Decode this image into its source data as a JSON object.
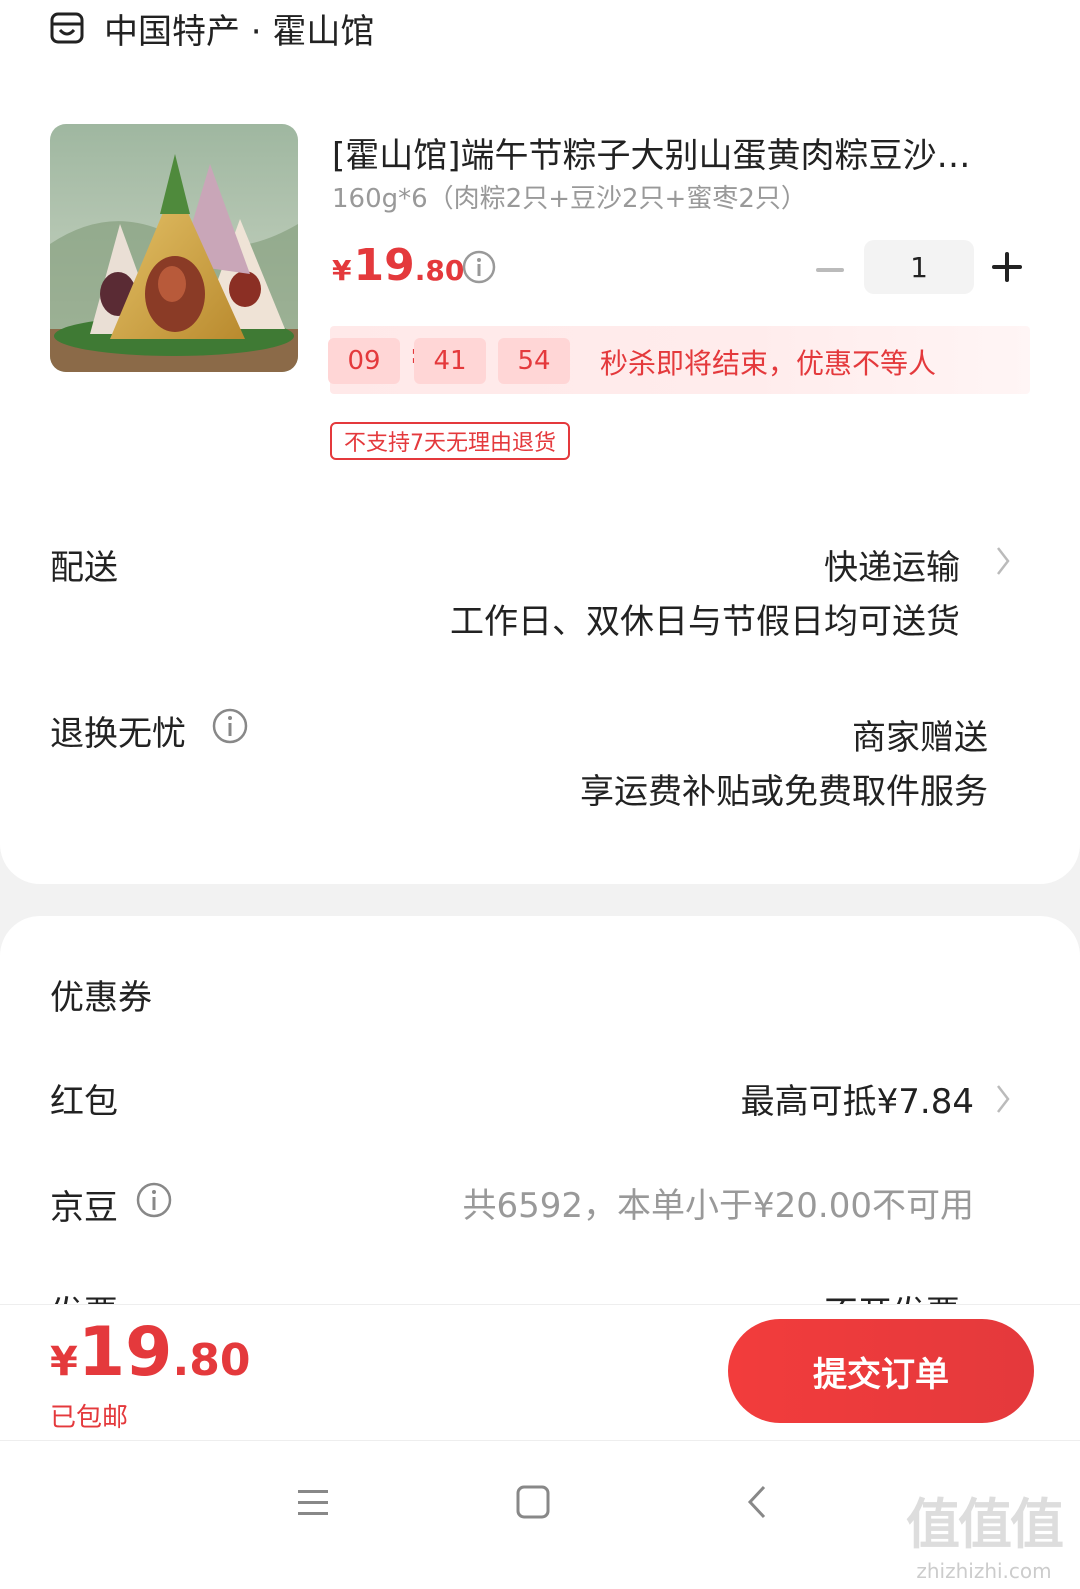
{
  "shop": {
    "icon": "store-icon",
    "name": "中国特产 · 霍山馆"
  },
  "product": {
    "image": "zongzi-product-image",
    "title": "[霍山馆]端午节粽子大别山蛋黄肉粽豆沙…",
    "spec": "160g*6（肉粽2只+豆沙2只+蜜枣2只）",
    "price": {
      "symbol": "¥",
      "integer": "19",
      "decimal": ".80"
    },
    "quantity": "1",
    "countdown": {
      "hours": "09",
      "minutes": "41",
      "seconds": "54",
      "message": "秒杀即将结束，优惠不等人"
    },
    "tag": "不支持7天无理由退货"
  },
  "delivery": {
    "label": "配送",
    "method": "快递运输",
    "detail": "工作日、双休日与节假日均可送货"
  },
  "returns": {
    "label": "退换无忧",
    "value": "商家赠送",
    "detail": "享运费补贴或免费取件服务"
  },
  "discounts": {
    "coupon_label": "优惠券",
    "redpacket_label": "红包",
    "redpacket_value": "最高可抵¥7.84",
    "jingdou_label": "京豆",
    "jingdou_value": "共6592，本单小于¥20.00不可用",
    "invoice_label": "发票",
    "invoice_value": "不开发票"
  },
  "checkout": {
    "total": {
      "symbol": "¥",
      "integer": "19",
      "decimal": ".80"
    },
    "shipping": "已包邮",
    "submit_label": "提交订单"
  },
  "navbar": {
    "icons": [
      "menu-icon",
      "home-icon",
      "back-icon"
    ]
  },
  "watermark": {
    "big": "值值值",
    "small": "zhizhizhi.com"
  },
  "colors": {
    "accent": "#e4393c",
    "muted": "#999999"
  }
}
